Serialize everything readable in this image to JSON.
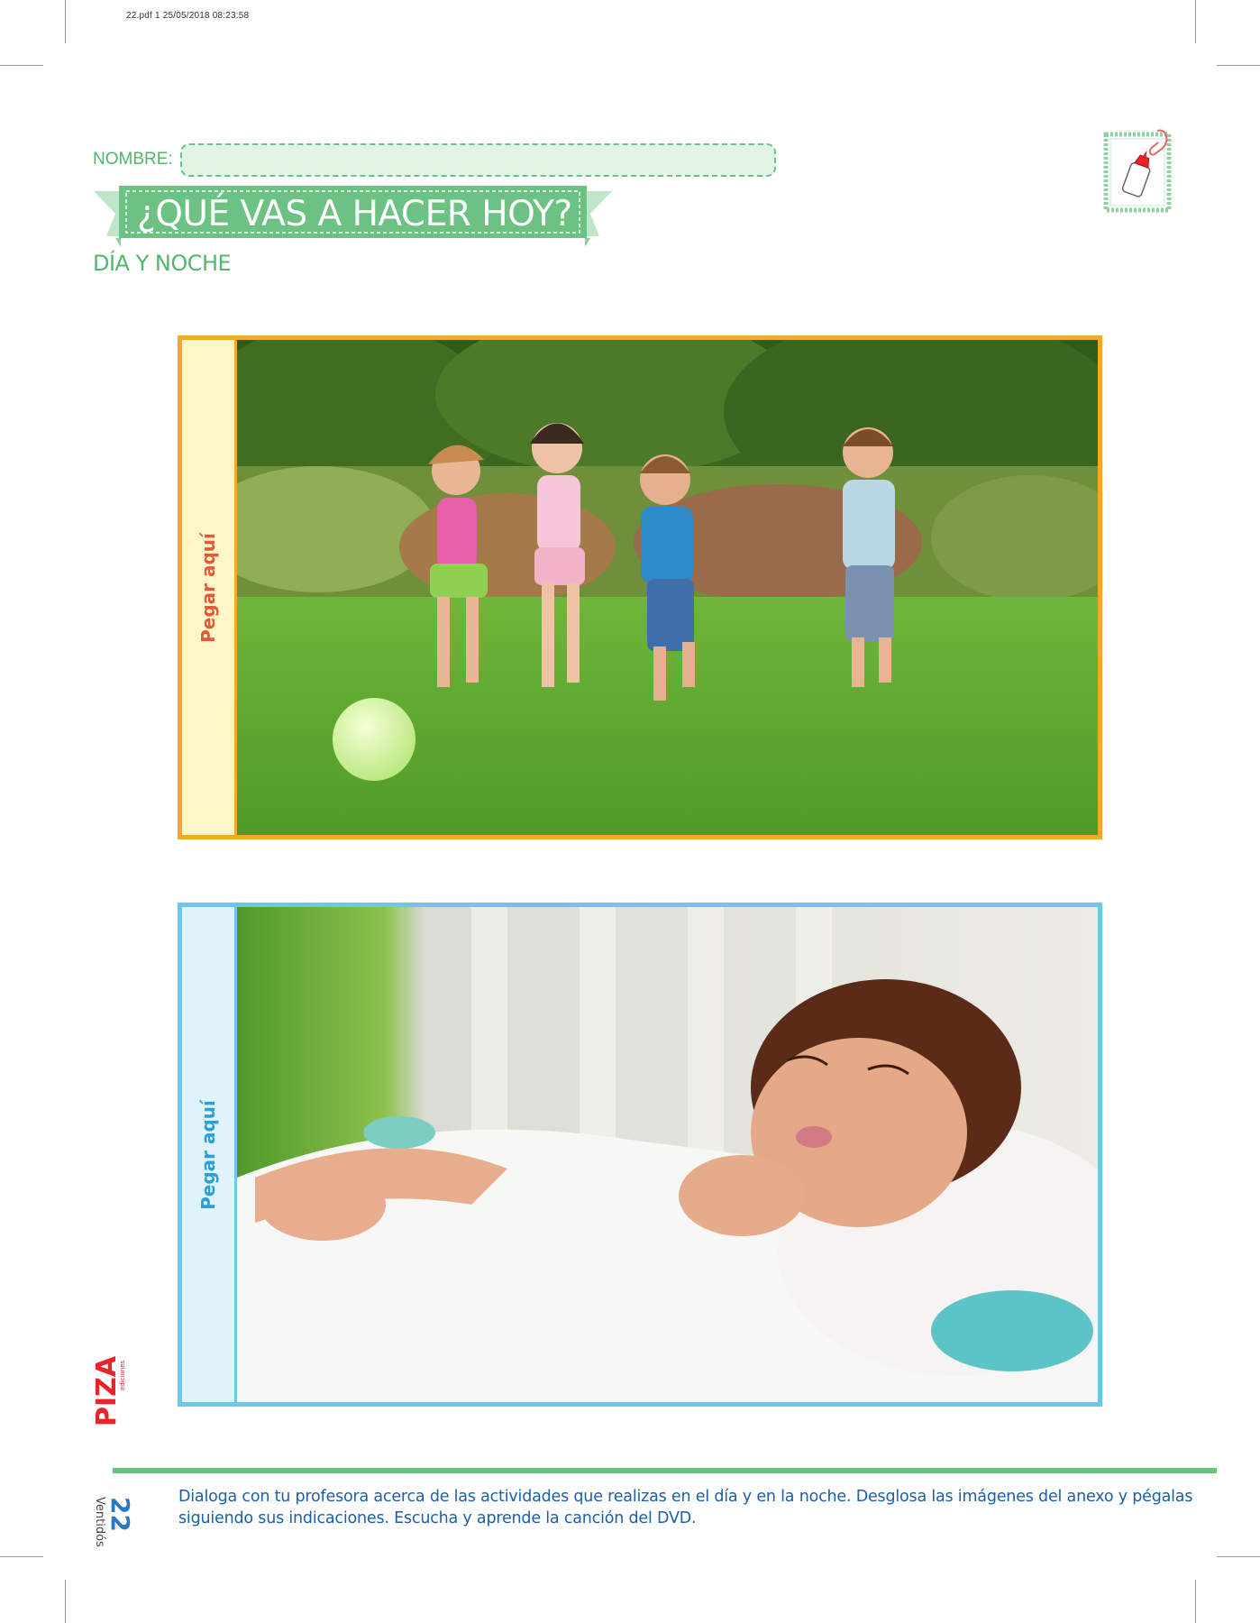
{
  "slug": "22.pdf   1   25/05/2018   08:23:58",
  "header": {
    "name_label": "NOMBRE:",
    "title": "¿QUÉ VAS A HACER HOY?",
    "subtitle": "DÍA Y NOCHE"
  },
  "colors": {
    "green": "#4fb86b",
    "orange": "#f0a928",
    "blue": "#6ec6ea",
    "text_blue": "#1d5ea8",
    "logo_red": "#e8232a"
  },
  "frames": [
    {
      "side_label": "Pegar aquí",
      "color": "orange",
      "photo": "children-playing-ball"
    },
    {
      "side_label": "Pegar aquí",
      "color": "blue",
      "photo": "child-sleeping"
    }
  ],
  "icons": {
    "header": "glue-bottle-icon",
    "logo": "editorial-logo"
  },
  "logo": {
    "brand": "PIZA",
    "tagline": "ediciones"
  },
  "footer": {
    "page_number": "22",
    "page_word": "Ventidós",
    "instructions": "Dialoga con tu profesora acerca de las actividades que realizas en el día y en la noche.  Desglosa las imágenes del anexo y pégalas siguiendo sus indicaciones. Escucha y aprende la canción del DVD."
  }
}
